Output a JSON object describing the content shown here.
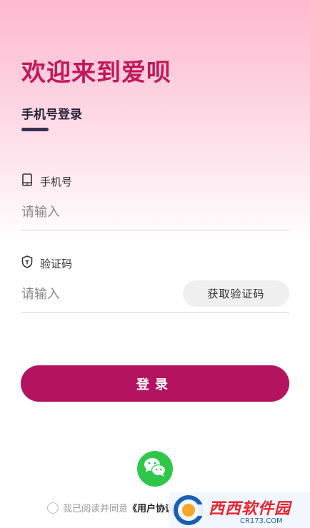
{
  "header": {
    "welcome_title": "欢迎来到爱呗",
    "login_tab": "手机号登录"
  },
  "phone_field": {
    "label": "手机号",
    "placeholder": "请输入",
    "icon": "phone-icon"
  },
  "code_field": {
    "label": "验证码",
    "placeholder": "请输入",
    "icon": "shield-icon",
    "get_code_label": "获取验证码"
  },
  "login_button": {
    "label": "登录"
  },
  "wechat": {
    "icon": "wechat-icon"
  },
  "agreement": {
    "text": "我已阅读并同意",
    "link": "《用户协议》"
  },
  "watermark": {
    "main": "西西软件园",
    "sub": "CR173.COM"
  },
  "colors": {
    "brand": "#c2185b",
    "button": "#b3135f",
    "wechat": "#2ec74a"
  }
}
